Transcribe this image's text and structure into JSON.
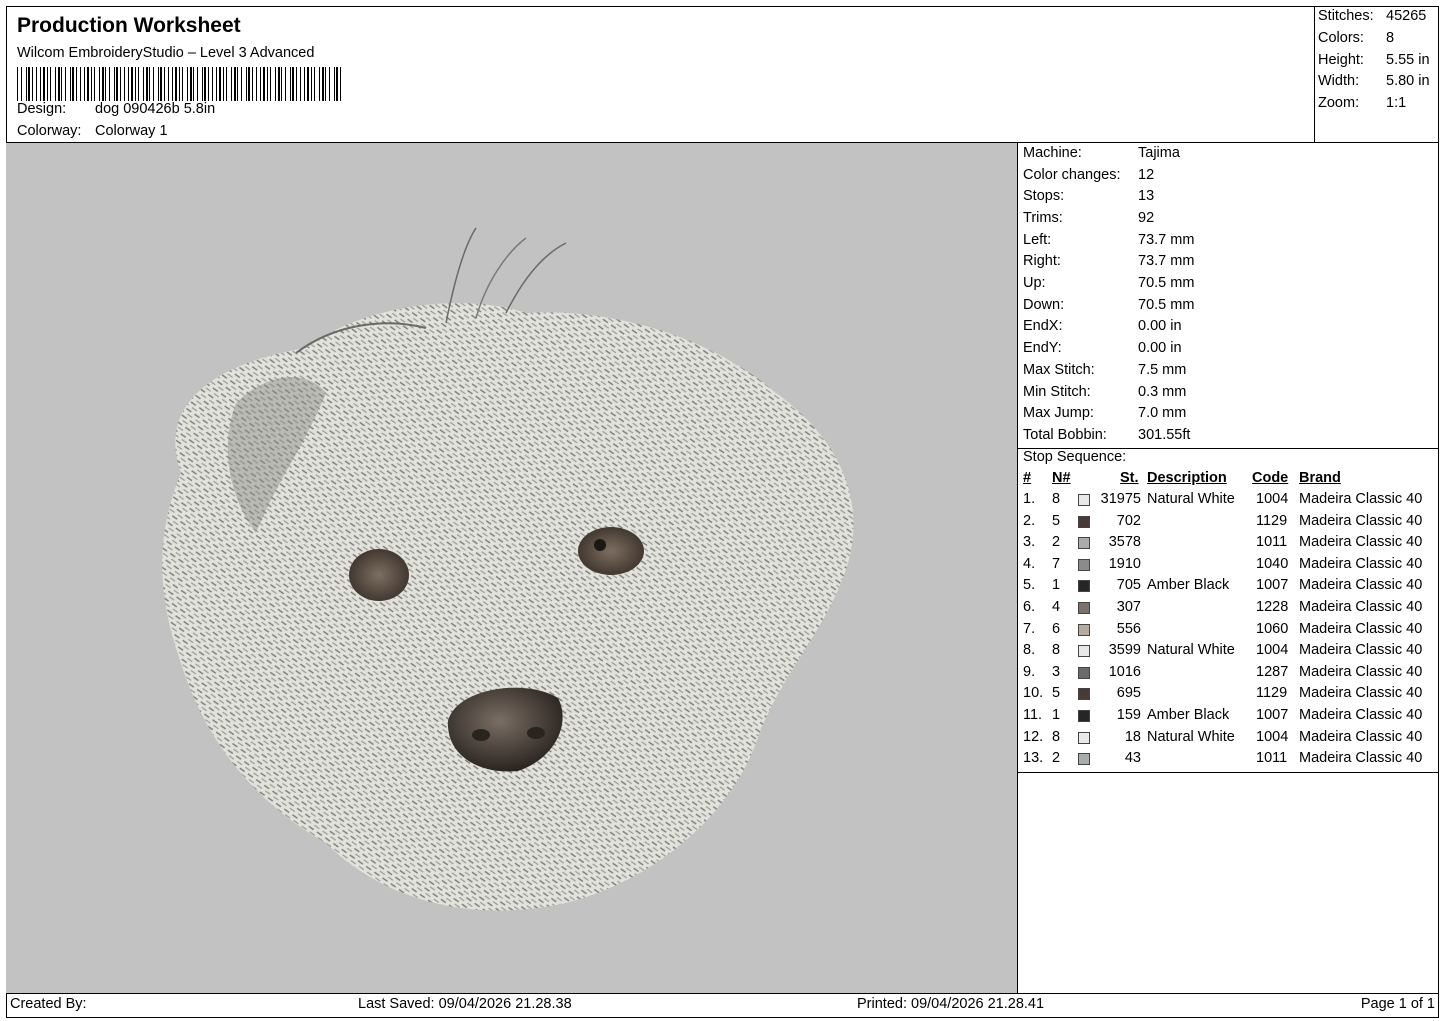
{
  "header": {
    "title": "Production Worksheet",
    "software": "Wilcom EmbroideryStudio – Level 3 Advanced",
    "design_label": "Design:",
    "design_value": "dog 090426b 5.8in",
    "colorway_label": "Colorway:",
    "colorway_value": "Colorway 1"
  },
  "summary": [
    {
      "label": "Stitches:",
      "value": "45265"
    },
    {
      "label": "Colors:",
      "value": "8"
    },
    {
      "label": "Height:",
      "value": "5.55 in"
    },
    {
      "label": "Width:",
      "value": "5.80 in"
    },
    {
      "label": "Zoom:",
      "value": "1:1"
    }
  ],
  "machine": [
    {
      "label": "Machine:",
      "value": "Tajima"
    },
    {
      "label": "Color changes:",
      "value": "12"
    },
    {
      "label": "Stops:",
      "value": "13"
    },
    {
      "label": "Trims:",
      "value": "92"
    },
    {
      "label": "Left:",
      "value": "73.7 mm"
    },
    {
      "label": "Right:",
      "value": "73.7 mm"
    },
    {
      "label": "Up:",
      "value": "70.5 mm"
    },
    {
      "label": "Down:",
      "value": "70.5 mm"
    },
    {
      "label": "EndX:",
      "value": "0.00 in"
    },
    {
      "label": "EndY:",
      "value": "0.00 in"
    },
    {
      "label": "Max Stitch:",
      "value": "7.5 mm"
    },
    {
      "label": "Min Stitch:",
      "value": "0.3 mm"
    },
    {
      "label": "Max Jump:",
      "value": "7.0 mm"
    },
    {
      "label": "Total Bobbin:",
      "value": "301.55ft"
    }
  ],
  "stop_sequence": {
    "heading": "Stop Sequence:",
    "columns": {
      "idx": "#",
      "n": "N#",
      "st": "St.",
      "desc": "Description",
      "code": "Code",
      "brand": "Brand"
    },
    "rows": [
      {
        "idx": "1.",
        "n": "8",
        "color": "#e9e9e9",
        "st": "31975",
        "desc": "Natural White",
        "code": "1004",
        "brand": "Madeira Classic 40"
      },
      {
        "idx": "2.",
        "n": "5",
        "color": "#4a3a36",
        "st": "702",
        "desc": "",
        "code": "1129",
        "brand": "Madeira Classic 40"
      },
      {
        "idx": "3.",
        "n": "2",
        "color": "#a8acad",
        "st": "3578",
        "desc": "",
        "code": "1011",
        "brand": "Madeira Classic 40"
      },
      {
        "idx": "4.",
        "n": "7",
        "color": "#8b8b8b",
        "st": "1910",
        "desc": "",
        "code": "1040",
        "brand": "Madeira Classic 40"
      },
      {
        "idx": "5.",
        "n": "1",
        "color": "#262626",
        "st": "705",
        "desc": "Amber Black",
        "code": "1007",
        "brand": "Madeira Classic 40"
      },
      {
        "idx": "6.",
        "n": "4",
        "color": "#7d716b",
        "st": "307",
        "desc": "",
        "code": "1228",
        "brand": "Madeira Classic 40"
      },
      {
        "idx": "7.",
        "n": "6",
        "color": "#b7ab9f",
        "st": "556",
        "desc": "",
        "code": "1060",
        "brand": "Madeira Classic 40"
      },
      {
        "idx": "8.",
        "n": "8",
        "color": "#e9e9e9",
        "st": "3599",
        "desc": "Natural White",
        "code": "1004",
        "brand": "Madeira Classic 40"
      },
      {
        "idx": "9.",
        "n": "3",
        "color": "#6b6b6b",
        "st": "1016",
        "desc": "",
        "code": "1287",
        "brand": "Madeira Classic 40"
      },
      {
        "idx": "10.",
        "n": "5",
        "color": "#4a3a36",
        "st": "695",
        "desc": "",
        "code": "1129",
        "brand": "Madeira Classic 40"
      },
      {
        "idx": "11.",
        "n": "1",
        "color": "#262626",
        "st": "159",
        "desc": "Amber Black",
        "code": "1007",
        "brand": "Madeira Classic 40"
      },
      {
        "idx": "12.",
        "n": "8",
        "color": "#e9e9e9",
        "st": "18",
        "desc": "Natural White",
        "code": "1004",
        "brand": "Madeira Classic 40"
      },
      {
        "idx": "13.",
        "n": "2",
        "color": "#a8acad",
        "st": "43",
        "desc": "",
        "code": "1011",
        "brand": "Madeira Classic 40"
      }
    ]
  },
  "footer": {
    "created_by": "Created By:",
    "last_saved": "Last Saved: 09/04/2026 21.28.38",
    "printed": "Printed: 09/04/2026 21.28.41",
    "page": "Page 1 of 1"
  },
  "colors": {
    "preview_background": "#c2c2c2"
  }
}
